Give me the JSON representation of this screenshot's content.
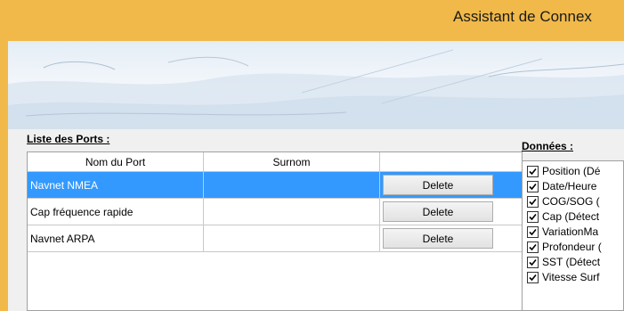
{
  "window": {
    "title": "Assistant de Connex"
  },
  "ports": {
    "title": "Liste des Ports :",
    "columns": [
      "Nom du Port",
      "Surnom",
      ""
    ],
    "rows": [
      {
        "name": "Navnet NMEA",
        "surnom": "",
        "button": "Delete",
        "selected": true
      },
      {
        "name": "Cap fréquence rapide",
        "surnom": "",
        "button": "Delete",
        "selected": false
      },
      {
        "name": "Navnet ARPA",
        "surnom": "",
        "button": "Delete",
        "selected": false
      }
    ]
  },
  "donnees": {
    "title": "Données :",
    "items": [
      {
        "label": "Position (Dé",
        "checked": true
      },
      {
        "label": "Date/Heure",
        "checked": true
      },
      {
        "label": "COG/SOG (",
        "checked": true
      },
      {
        "label": "Cap (Détect",
        "checked": true
      },
      {
        "label": "VariationMa",
        "checked": true
      },
      {
        "label": "Profondeur (",
        "checked": true
      },
      {
        "label": "SST (Détect",
        "checked": true
      },
      {
        "label": "Vitesse Surf",
        "checked": true
      }
    ]
  },
  "colors": {
    "title_bar": "#f0b94a",
    "selection": "#3399ff",
    "background": "#f0f0f0"
  }
}
